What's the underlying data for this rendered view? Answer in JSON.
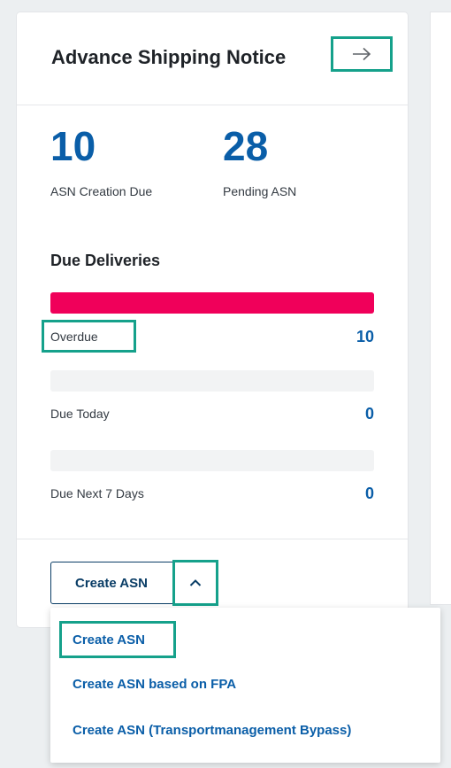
{
  "card": {
    "title": "Advance Shipping Notice"
  },
  "kpis": [
    {
      "value": "10",
      "label": "ASN Creation Due"
    },
    {
      "value": "28",
      "label": "Pending ASN"
    }
  ],
  "deliveries": {
    "title": "Due Deliveries",
    "rows": [
      {
        "label": "Overdue",
        "value": "10",
        "fill_fraction": 1.0
      },
      {
        "label": "Due Today",
        "value": "0",
        "fill_fraction": 0
      },
      {
        "label": "Due Next 7 Days",
        "value": "0",
        "fill_fraction": 0
      }
    ]
  },
  "create_button": {
    "label": "Create ASN"
  },
  "dropdown": {
    "items": [
      "Create ASN",
      "Create ASN based on FPA",
      "Create ASN (Transportmanagement Bypass)"
    ]
  },
  "icons": {
    "nav": "arrow-right-icon",
    "toggle": "chevron-up-icon"
  },
  "colors": {
    "accent": "#0a5ea8",
    "overdue_bar": "#f0005a",
    "highlight": "#15a18b",
    "button_border": "#0a3d66"
  }
}
